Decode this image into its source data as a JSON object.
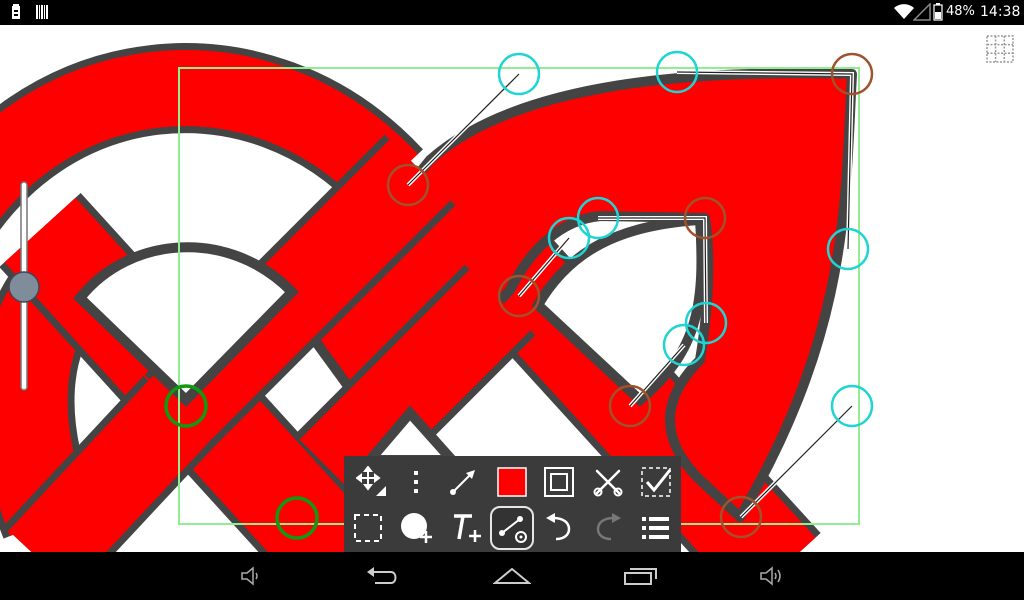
{
  "status_bar": {
    "battery_percent": "48%",
    "time": "14:38",
    "icons": [
      "usb-storage-icon",
      "barcode-icon",
      "wifi-icon",
      "signal-icon",
      "battery-icon"
    ]
  },
  "editor": {
    "shape_fill_color": "#ff0000",
    "shape_outline_color": "#444444",
    "selection_color": "#90ee90",
    "node_color": "#a0522d",
    "control_point_color": "#20d4d4",
    "selected_node_color": "#119911"
  },
  "toolbar": {
    "active_tool": "edit-nodes",
    "current_color": "#ff0000",
    "row1": [
      "move-resize-icon",
      "more-vertical-icon",
      "line-arrow-icon",
      "fill-color-swatch",
      "stroke-style-icon",
      "tools-icon",
      "finish-check-icon"
    ],
    "row2": [
      "select-region-icon",
      "add-shape-icon",
      "add-text-icon",
      "edit-nodes-icon",
      "undo-icon",
      "redo-icon",
      "layers-menu-icon"
    ]
  },
  "nav_bar": {
    "buttons": [
      "volume-down-icon",
      "back-icon",
      "home-icon",
      "recents-icon",
      "volume-up-icon"
    ]
  }
}
